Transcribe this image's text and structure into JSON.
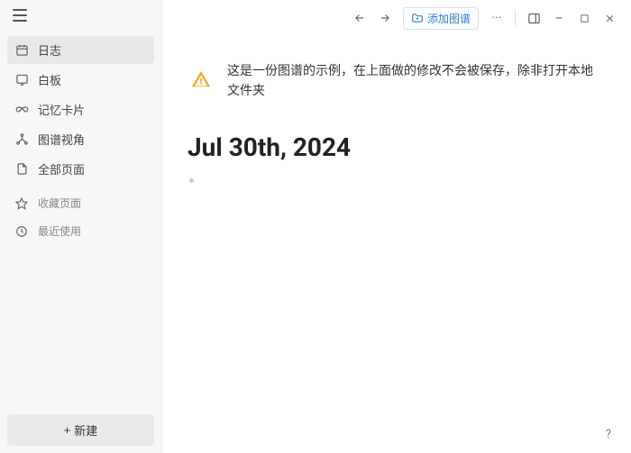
{
  "sidebar": {
    "items": [
      {
        "label": "日志"
      },
      {
        "label": "白板"
      },
      {
        "label": "记忆卡片"
      },
      {
        "label": "图谱视角"
      },
      {
        "label": "全部页面"
      }
    ],
    "secondary": [
      {
        "label": "收藏页面"
      },
      {
        "label": "最近使用"
      }
    ],
    "new_button": "新建"
  },
  "topbar": {
    "add_graph_label": "添加图谱",
    "more": "···"
  },
  "alert": {
    "text": "这是一份图谱的示例，在上面做的修改不会被保存，除非打开本地文件夹"
  },
  "page": {
    "title": "Jul 30th, 2024"
  },
  "help": "?"
}
